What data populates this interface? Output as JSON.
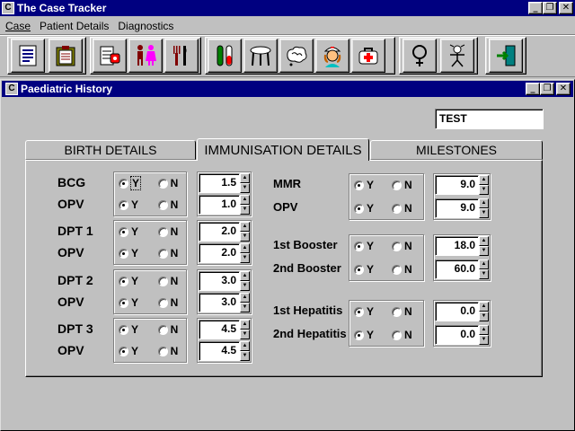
{
  "app": {
    "title": "The Case Tracker",
    "icon": "app-icon"
  },
  "menu": [
    "Case",
    "Patient Details",
    "Diagnostics"
  ],
  "toolbar": [
    {
      "icon": "document-icon"
    },
    {
      "icon": "clipboard-icon"
    },
    {
      "icon": "phone-book-icon"
    },
    {
      "icon": "family-icon"
    },
    {
      "icon": "cutlery-icon"
    },
    {
      "icon": "test-tube-icon"
    },
    {
      "icon": "stool-icon"
    },
    {
      "icon": "brain-icon"
    },
    {
      "icon": "nurse-icon"
    },
    {
      "icon": "medical-bag-icon"
    },
    {
      "icon": "female-symbol-icon"
    },
    {
      "icon": "child-icon"
    },
    {
      "icon": "exit-icon"
    }
  ],
  "window": {
    "title": "Paediatric History",
    "patient_name": "TEST"
  },
  "tabs": [
    "BIRTH DETAILS",
    "IMMUNISATION DETAILS",
    "MILESTONES"
  ],
  "active_tab": 1,
  "radio_labels": {
    "yes": "Y",
    "no": "N"
  },
  "left_groups": [
    {
      "rows": [
        {
          "label": "BCG",
          "selected": "Y",
          "value": "1.5"
        },
        {
          "label": "OPV",
          "selected": "Y",
          "value": "1.0"
        }
      ]
    },
    {
      "rows": [
        {
          "label": "DPT 1",
          "selected": "Y",
          "value": "2.0"
        },
        {
          "label": "OPV",
          "selected": "Y",
          "value": "2.0"
        }
      ]
    },
    {
      "rows": [
        {
          "label": "DPT 2",
          "selected": "Y",
          "value": "3.0"
        },
        {
          "label": "OPV",
          "selected": "Y",
          "value": "3.0"
        }
      ]
    },
    {
      "rows": [
        {
          "label": "DPT 3",
          "selected": "Y",
          "value": "4.5"
        },
        {
          "label": "OPV",
          "selected": "Y",
          "value": "4.5"
        }
      ]
    }
  ],
  "right_groups": [
    {
      "rows": [
        {
          "label": "MMR",
          "selected": "Y",
          "value": "9.0"
        },
        {
          "label": "OPV",
          "selected": "Y",
          "value": "9.0"
        }
      ]
    },
    {
      "rows": [
        {
          "label": "1st Booster",
          "selected": "Y",
          "value": "18.0"
        },
        {
          "label": "2nd Booster",
          "selected": "Y",
          "value": "60.0"
        }
      ]
    },
    {
      "rows": [
        {
          "label": "1st Hepatitis",
          "selected": "Y",
          "value": "0.0"
        },
        {
          "label": "2nd Hepatitis",
          "selected": "Y",
          "value": "0.0"
        }
      ]
    }
  ],
  "colors": {
    "titlebar": "#000080",
    "face": "#c0c0c0"
  }
}
